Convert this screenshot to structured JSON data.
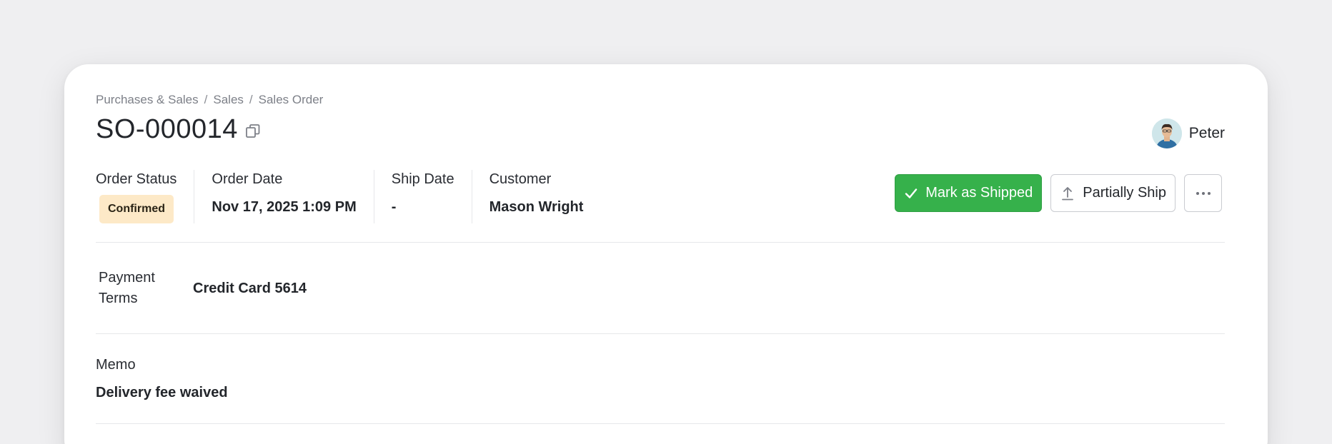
{
  "breadcrumb": {
    "items": [
      "Purchases & Sales",
      "Sales",
      "Sales Order"
    ],
    "separator": "/"
  },
  "header": {
    "title": "SO-000014",
    "copy_icon": "copy-icon"
  },
  "user": {
    "name": "Peter",
    "avatar_icon": "user-avatar"
  },
  "info": {
    "order_status": {
      "label": "Order Status",
      "value": "Confirmed"
    },
    "order_date": {
      "label": "Order Date",
      "value": "Nov 17, 2025 1:09 PM"
    },
    "ship_date": {
      "label": "Ship Date",
      "value": "-"
    },
    "customer": {
      "label": "Customer",
      "value": "Mason Wright"
    }
  },
  "actions": {
    "mark_shipped": {
      "label": "Mark as Shipped",
      "icon": "check-icon",
      "color": "#36b14b"
    },
    "partially_ship": {
      "label": "Partially Ship",
      "icon": "upload-icon"
    },
    "more": {
      "icon": "more-horizontal-icon"
    }
  },
  "payment": {
    "label": "Payment Terms",
    "value": "Credit Card 5614"
  },
  "memo": {
    "label": "Memo",
    "value": "Delivery fee waived"
  },
  "colors": {
    "status_badge_bg": "#fde9c7",
    "primary": "#36b14b"
  }
}
